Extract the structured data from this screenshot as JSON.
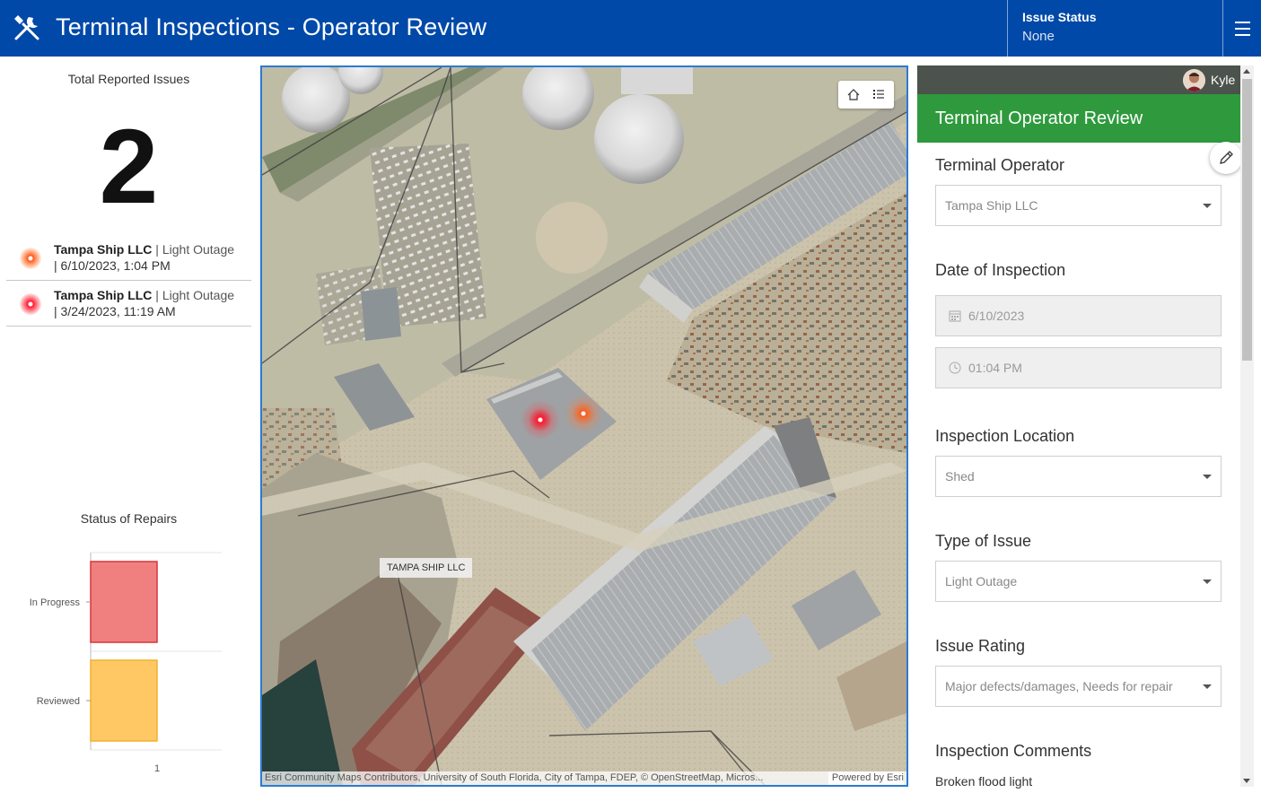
{
  "header": {
    "title": "Terminal Inspections - Operator Review",
    "status_label": "Issue Status",
    "status_value": "None",
    "colors": {
      "background": "#0049a8"
    },
    "icons": {
      "app": "tools-icon",
      "menu": "hamburger-menu-icon"
    }
  },
  "summary": {
    "total_title": "Total Reported Issues",
    "total_value": "2"
  },
  "issues": [
    {
      "operator": "Tampa Ship LLC",
      "type": "Light Outage",
      "date": "6/10/2023, 1:04 PM",
      "marker_color": "#ff5a1f"
    },
    {
      "operator": "Tampa Ship LLC",
      "type": "Light Outage",
      "date": "3/24/2023, 11:19 AM",
      "marker_color": "#ff1a2e"
    }
  ],
  "repairs": {
    "title": "Status of Repairs"
  },
  "chart_data": {
    "type": "bar",
    "orientation": "horizontal",
    "categories": [
      "In Progress",
      "Reviewed"
    ],
    "values": [
      1,
      1
    ],
    "colors": [
      "#f08080",
      "#ffc864"
    ],
    "xlim": [
      0,
      1
    ],
    "xticks": [
      "1"
    ],
    "grid": true
  },
  "map": {
    "label": "TAMPA SHIP LLC",
    "attribution": "Esri Community Maps Contributors, University of South Florida, City of Tampa, FDEP, © OpenStreetMap, Micros...",
    "powered_by": "Powered by Esri",
    "tools": [
      "home-icon",
      "legend-list-icon"
    ]
  },
  "form": {
    "user": "Kyle",
    "title": "Terminal Operator Review",
    "header_color": "#2f9a3d",
    "fields": {
      "operator": {
        "label": "Terminal Operator",
        "value": "Tampa Ship LLC"
      },
      "date": {
        "label": "Date of Inspection",
        "date_value": "6/10/2023",
        "time_value": "01:04 PM"
      },
      "location": {
        "label": "Inspection Location",
        "value": "Shed"
      },
      "issue_type": {
        "label": "Type of Issue",
        "value": "Light Outage"
      },
      "rating": {
        "label": "Issue Rating",
        "value": "Major defects/damages, Needs for repair"
      },
      "comments": {
        "label": "Inspection Comments",
        "value": "Broken flood light"
      }
    }
  }
}
